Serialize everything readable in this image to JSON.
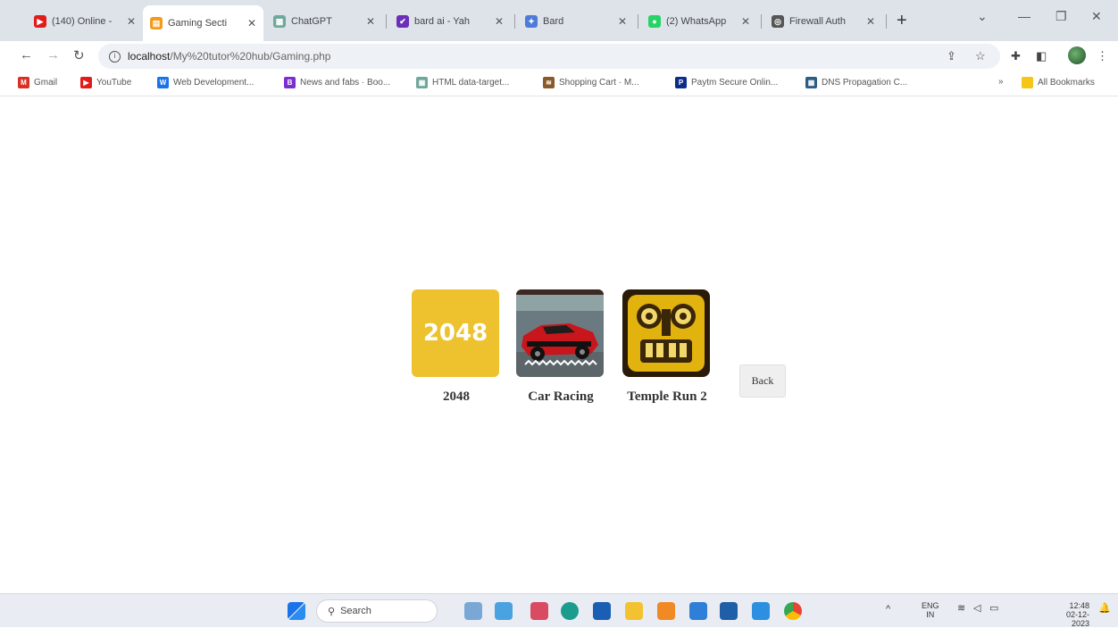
{
  "browser": {
    "tabs": [
      {
        "label": "(140) Online -",
        "fav_color": "#e21b1b",
        "fav_glyph": "▶",
        "active": false
      },
      {
        "label": "Gaming Secti",
        "fav_color": "#f19a1c",
        "fav_glyph": "▤",
        "active": true
      },
      {
        "label": "ChatGPT",
        "fav_color": "#6ea89c",
        "fav_glyph": "▦",
        "active": false
      },
      {
        "label": "bard ai - Yah",
        "fav_color": "#6b2fb8",
        "fav_glyph": "✔",
        "active": false
      },
      {
        "label": "Bard",
        "fav_color": "#4c7bd9",
        "fav_glyph": "✦",
        "active": false
      },
      {
        "label": "(2) WhatsApp",
        "fav_color": "#25d366",
        "fav_glyph": "●",
        "active": false
      },
      {
        "label": "Firewall Auth",
        "fav_color": "#555555",
        "fav_glyph": "◎",
        "active": false
      }
    ],
    "url_host": "localhost",
    "url_path": "/My%20tutor%20hub/Gaming.php",
    "bookmarks": [
      {
        "label": "Gmail",
        "color": "#d93025",
        "glyph": "M"
      },
      {
        "label": "YouTube",
        "color": "#e21b1b",
        "glyph": "▶"
      },
      {
        "label": "Web Development...",
        "color": "#1a73e8",
        "glyph": "W"
      },
      {
        "label": "News and fabs · Boo...",
        "color": "#7b2fd0",
        "glyph": "B"
      },
      {
        "label": "HTML data-target...",
        "color": "#6ea89c",
        "glyph": "▦"
      },
      {
        "label": "Shopping Cart · M...",
        "color": "#8a5a2b",
        "glyph": "≋"
      },
      {
        "label": "Paytm Secure Onlin...",
        "color": "#0b2e8a",
        "glyph": "P"
      },
      {
        "label": "DNS Propagation C...",
        "color": "#2b5d86",
        "glyph": "▦"
      }
    ],
    "all_bookmarks": "All Bookmarks"
  },
  "page": {
    "games": [
      {
        "name": "2048",
        "thumb_text": "2048"
      },
      {
        "name": "Car Racing"
      },
      {
        "name": "Temple Run 2"
      }
    ],
    "back_label": "Back"
  },
  "taskbar": {
    "search_label": "Search",
    "lang_top": "ENG",
    "lang_bottom": "IN",
    "time": "12:48",
    "date": "02-12-2023"
  }
}
